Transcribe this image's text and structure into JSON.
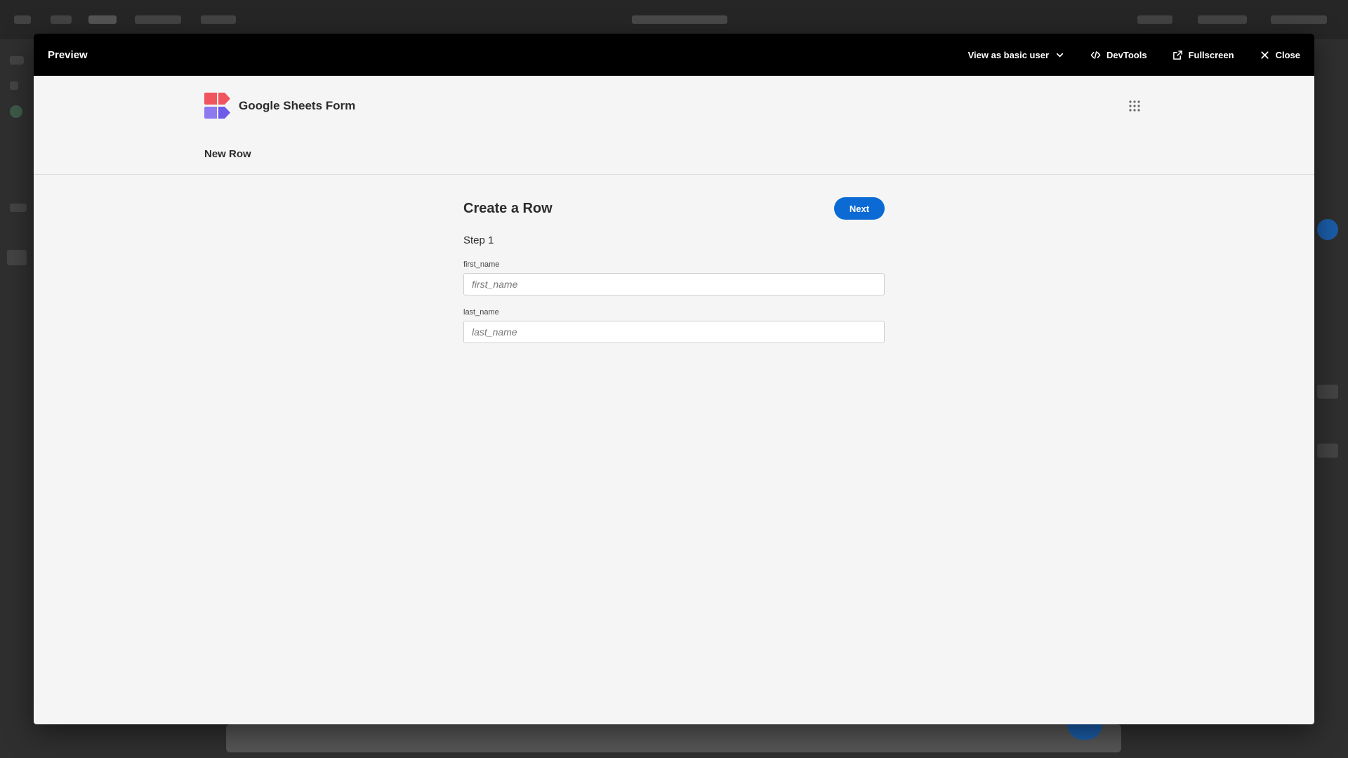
{
  "modal": {
    "title": "Preview",
    "actions": {
      "view_as": "View as basic user",
      "devtools": "DevTools",
      "fullscreen": "Fullscreen",
      "close": "Close"
    }
  },
  "app": {
    "brand_name": "Google Sheets Form",
    "nav_link": "New Row"
  },
  "form": {
    "title": "Create a Row",
    "next_label": "Next",
    "step_label": "Step 1",
    "fields": [
      {
        "label": "first_name",
        "placeholder": "first_name",
        "value": ""
      },
      {
        "label": "last_name",
        "placeholder": "last_name",
        "value": ""
      }
    ]
  },
  "colors": {
    "accent": "#0b6ad4",
    "header_bg": "#000000",
    "content_bg": "#f5f5f5",
    "logo_red": "#f0545e",
    "logo_purple": "#8d7af0"
  },
  "icons": {
    "view_as": "chevron-down-icon",
    "devtools": "code-icon",
    "fullscreen": "external-link-icon",
    "close": "close-icon",
    "app_switcher": "grid-icon"
  }
}
